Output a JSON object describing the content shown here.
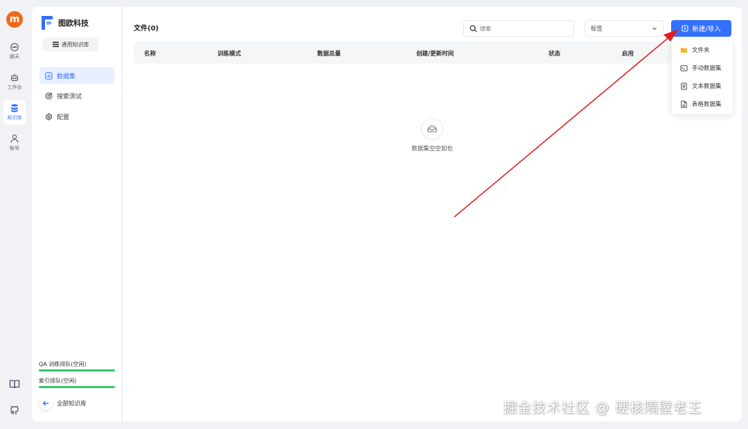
{
  "user": {
    "avatar_letter": "m"
  },
  "nav": {
    "items": [
      {
        "label": "聊天",
        "icon": "chat-icon"
      },
      {
        "label": "工作台",
        "icon": "robot-icon"
      },
      {
        "label": "知识库",
        "icon": "database-icon"
      },
      {
        "label": "账号",
        "icon": "user-icon"
      }
    ],
    "bottom_icons": [
      "book-icon",
      "github-icon"
    ]
  },
  "sidebar": {
    "brand": "图欧科技",
    "kb_chip": "通用知识库",
    "items": [
      {
        "label": "数据集",
        "icon": "chart-icon"
      },
      {
        "label": "搜索测试",
        "icon": "target-icon"
      },
      {
        "label": "配置",
        "icon": "gear-icon"
      }
    ],
    "queue_qa": "QA 训练排队(空闲)",
    "queue_index": "索引排队(空闲)",
    "back_label": "全部知识库"
  },
  "main": {
    "title": "文件(0)",
    "search_placeholder": "搜索",
    "tag_select": "标签",
    "new_button": "新建/导入",
    "columns": [
      "名称",
      "训练模式",
      "数据总量",
      "创建/更新时间",
      "状态",
      "启用"
    ],
    "empty_text": "数据集空空如也"
  },
  "dropdown": {
    "items": [
      {
        "label": "文件夹",
        "icon": "folder-icon"
      },
      {
        "label": "手动数据集",
        "icon": "manual-icon"
      },
      {
        "label": "文本数据集",
        "icon": "text-doc-icon"
      },
      {
        "label": "表格数据集",
        "icon": "table-doc-icon"
      }
    ]
  },
  "colors": {
    "accent": "#3370ff",
    "avatar": "#f06a18",
    "queue_bar": "#35c46c",
    "annotation_arrow": "#e02020"
  },
  "watermark": "掘金技术社区 @ 硬核隔壁老王"
}
